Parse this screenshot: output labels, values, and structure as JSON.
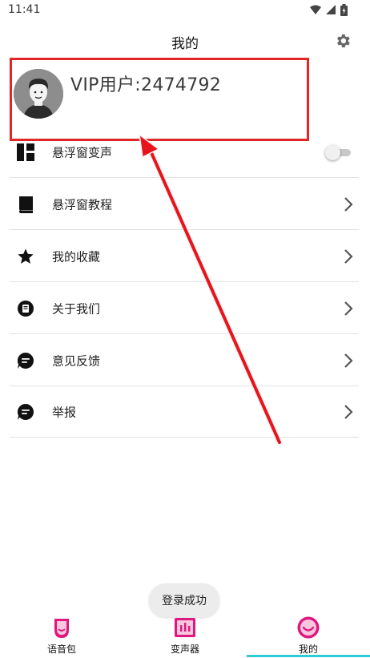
{
  "status_bar": {
    "time": "11:41"
  },
  "header": {
    "title": "我的",
    "settings_icon": "gear-icon"
  },
  "profile": {
    "username": "VIP用户:2474792",
    "avatar_icon": "user-avatar"
  },
  "menu": [
    {
      "label": "悬浮窗变声",
      "icon": "layout-icon",
      "control": "toggle",
      "toggle_on": false
    },
    {
      "label": "悬浮窗教程",
      "icon": "book-icon",
      "control": "chevron"
    },
    {
      "label": "我的收藏",
      "icon": "star-icon",
      "control": "chevron"
    },
    {
      "label": "关于我们",
      "icon": "info-icon",
      "control": "chevron"
    },
    {
      "label": "意见反馈",
      "icon": "chat-icon",
      "control": "chevron"
    },
    {
      "label": "举报",
      "icon": "chat-icon",
      "control": "chevron"
    }
  ],
  "toast": {
    "message": "登录成功"
  },
  "bottom_nav": {
    "tabs": [
      {
        "label": "语音包",
        "icon": "voice-pack-icon"
      },
      {
        "label": "变声器",
        "icon": "voice-changer-icon"
      },
      {
        "label": "我的",
        "icon": "me-icon",
        "active": true
      }
    ]
  },
  "colors": {
    "accent": "#e0177e",
    "highlight_box": "#e02626",
    "nav_indicator": "#2ecad6"
  }
}
